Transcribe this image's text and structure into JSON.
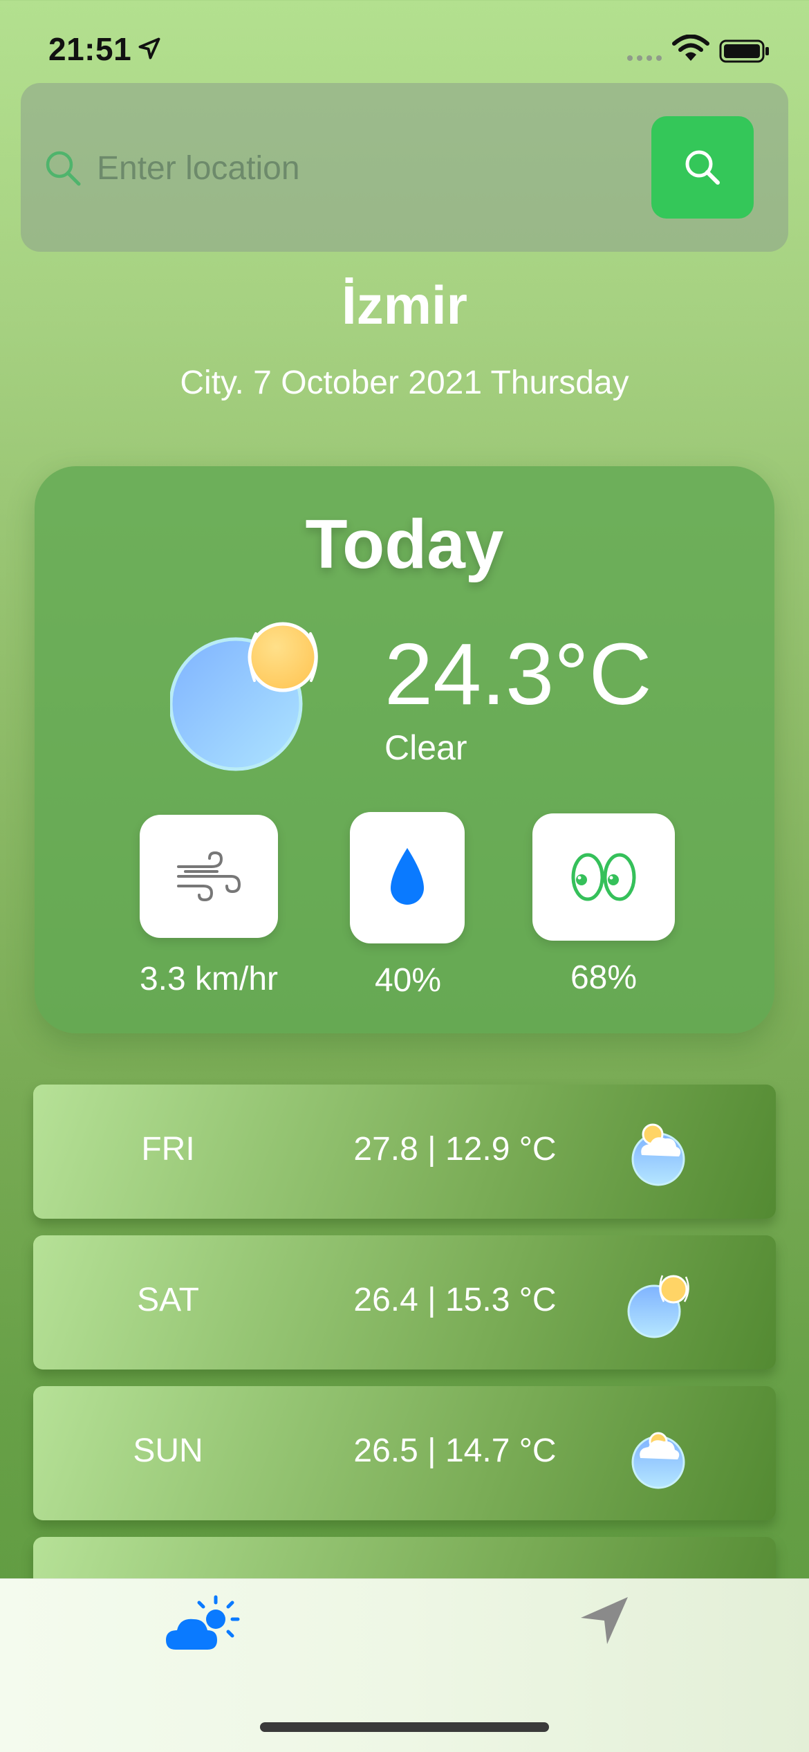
{
  "status_bar": {
    "time": "21:51"
  },
  "search": {
    "placeholder": "Enter location",
    "value": ""
  },
  "location": {
    "city": "İzmir",
    "date": "City. 7 October 2021 Thursday"
  },
  "today": {
    "title": "Today",
    "temperature": "24.3°C",
    "condition": "Clear",
    "wind": "3.3 km/hr",
    "humidity": "40%",
    "visibility": "68%"
  },
  "forecast": [
    {
      "day": "FRI",
      "range": "27.8 | 12.9 °C",
      "icon": "partly-cloudy-icon"
    },
    {
      "day": "SAT",
      "range": "26.4 | 15.3 °C",
      "icon": "sunny-icon"
    },
    {
      "day": "SUN",
      "range": "26.5 | 14.7 °C",
      "icon": "partly-cloudy-icon"
    }
  ],
  "tabbar": {
    "items": [
      {
        "icon": "weather-icon",
        "active": true
      },
      {
        "icon": "location-arrow-icon",
        "active": false
      }
    ]
  },
  "colors": {
    "accent_green": "#34c759",
    "tab_active": "#0a7aff",
    "tab_inactive": "#8a8a8a"
  }
}
